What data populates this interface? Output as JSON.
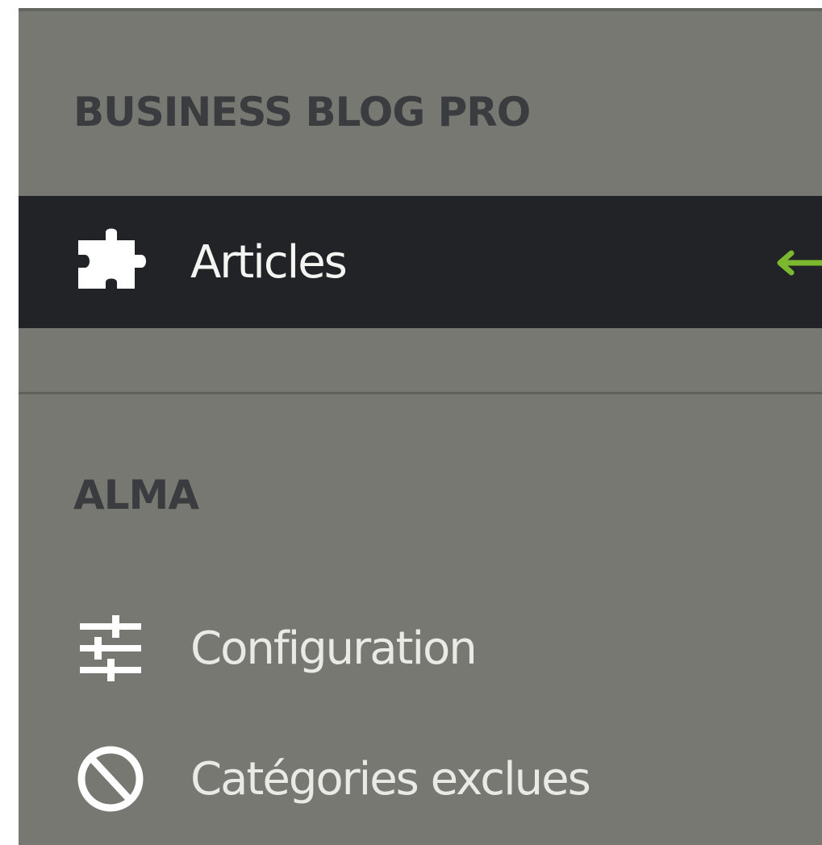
{
  "sidebar": {
    "sections": [
      {
        "title": "BUSINESS BLOG PRO",
        "items": [
          {
            "label": "Articles",
            "icon": "puzzle-piece-icon",
            "active": true
          }
        ]
      },
      {
        "title": "ALMA",
        "items": [
          {
            "label": "Configuration",
            "icon": "sliders-icon",
            "active": false
          },
          {
            "label": "Catégories exclues",
            "icon": "ban-icon",
            "active": false
          }
        ]
      }
    ],
    "active_indicator_icon": "arrow-left-icon"
  },
  "colors": {
    "panel_bg": "#767871",
    "active_bg": "#222326",
    "section_title": "#3a3c40",
    "item_text": "#f4f4f2",
    "accent": "#7cb82f"
  }
}
